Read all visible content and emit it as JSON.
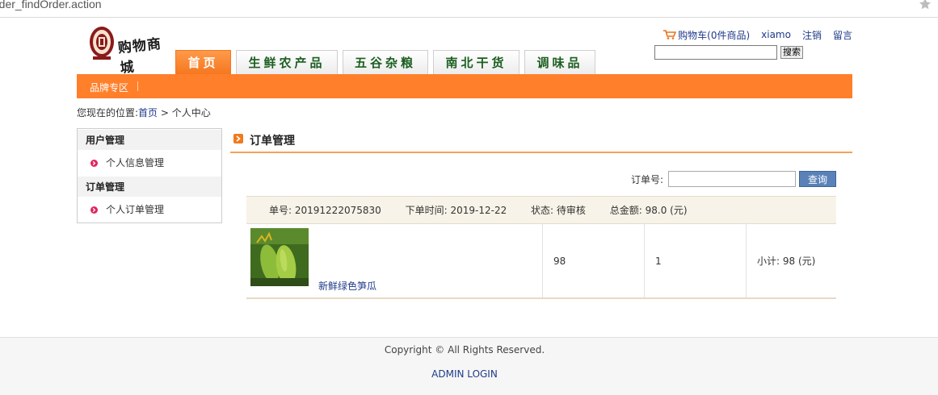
{
  "browser": {
    "url": "rder_findOrder.action"
  },
  "header": {
    "logo_text": "购物商城",
    "cart_label": "购物车(0件商品)",
    "username": "xiamo",
    "logout_label": "注销",
    "message_label": "留言",
    "search_placeholder": "",
    "search_button": "搜索"
  },
  "tabs": [
    {
      "label": "首页",
      "active": true
    },
    {
      "label": "生鲜农产品",
      "active": false
    },
    {
      "label": "五谷杂粮",
      "active": false
    },
    {
      "label": "南北干货",
      "active": false
    },
    {
      "label": "调味品",
      "active": false
    }
  ],
  "navbar": {
    "brand_zone": "品牌专区"
  },
  "breadcrumb": {
    "prefix": "您现在的位置:",
    "home": "首页",
    "separator": " > ",
    "current": "个人中心"
  },
  "sidebar": {
    "sections": [
      {
        "title": "用户管理",
        "items": [
          "个人信息管理"
        ]
      },
      {
        "title": "订单管理",
        "items": [
          "个人订单管理"
        ]
      }
    ]
  },
  "main": {
    "title": "订单管理",
    "order_search_label": "订单号:",
    "order_search_value": "",
    "query_button": "查询",
    "order": {
      "number_label": "单号:",
      "number": "20191222075830",
      "time_label": "下单时间:",
      "time": "2019-12-22",
      "status_label": "状态:",
      "status": "待审核",
      "total_label": "总金额:",
      "total": "98.0 (元)",
      "items": [
        {
          "name": "新鲜绿色笋瓜",
          "price": "98",
          "quantity": "1",
          "subtotal": "小计: 98 (元)"
        }
      ]
    }
  },
  "footer": {
    "copyright": "Copyright © All Rights Reserved.",
    "admin_login": "ADMIN LOGIN"
  },
  "colors": {
    "accent": "#ff7f2a",
    "link": "#1e3a8a",
    "tab_text": "#1b5e20",
    "query_button": "#5a82b8"
  }
}
